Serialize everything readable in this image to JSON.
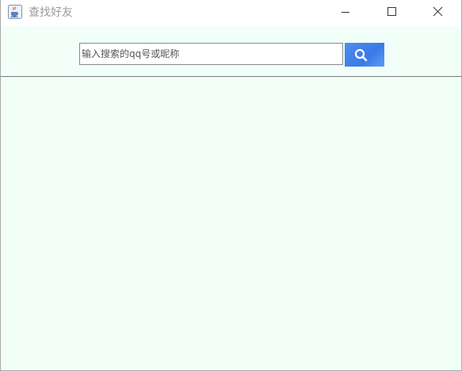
{
  "window": {
    "title": "查找好友",
    "app_icon": "java-cup-icon",
    "controls": {
      "minimize_icon": "minimize-icon",
      "maximize_icon": "maximize-icon",
      "close_icon": "close-icon"
    }
  },
  "search": {
    "placeholder": "输入搜索的qq号或昵称",
    "value": "",
    "button_icon": "search-icon",
    "button_color": "#4a86ee"
  },
  "results": {
    "items": []
  },
  "colors": {
    "content_background": "#f2fff9",
    "titlebar_background": "#ffffff",
    "title_text": "#9a9a9a"
  }
}
